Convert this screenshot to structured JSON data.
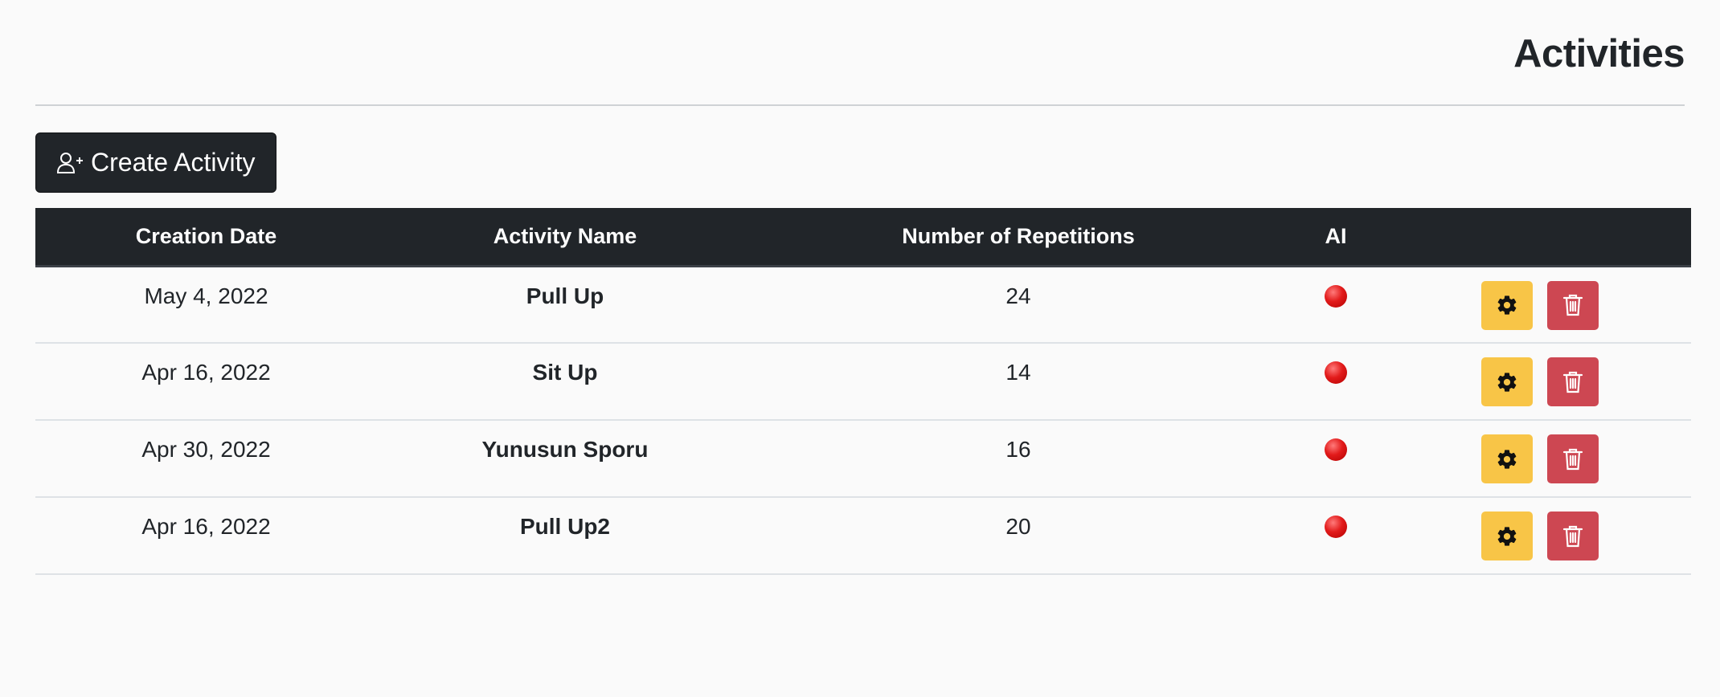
{
  "header": {
    "title": "Activities"
  },
  "toolbar": {
    "create_label": "Create Activity",
    "create_icon": "person-plus-icon"
  },
  "table": {
    "columns": [
      "Creation Date",
      "Activity Name",
      "Number of Repetitions",
      "AI",
      ""
    ],
    "rows": [
      {
        "date": "May 4, 2022",
        "name": "Pull Up",
        "reps": "24",
        "ai": "red-circle-icon"
      },
      {
        "date": "Apr 16, 2022",
        "name": "Sit Up",
        "reps": "14",
        "ai": "red-circle-icon"
      },
      {
        "date": "Apr 30, 2022",
        "name": "Yunusun Sporu",
        "reps": "16",
        "ai": "red-circle-icon"
      },
      {
        "date": "Apr 16, 2022",
        "name": "Pull Up2",
        "reps": "20",
        "ai": "red-circle-icon"
      }
    ],
    "row_actions": {
      "edit_icon": "gear-icon",
      "delete_icon": "trash-icon"
    }
  },
  "colors": {
    "dark": "#212529",
    "edit": "#f8c547",
    "delete": "#cd4752",
    "ai_status": "#e21b1b"
  }
}
